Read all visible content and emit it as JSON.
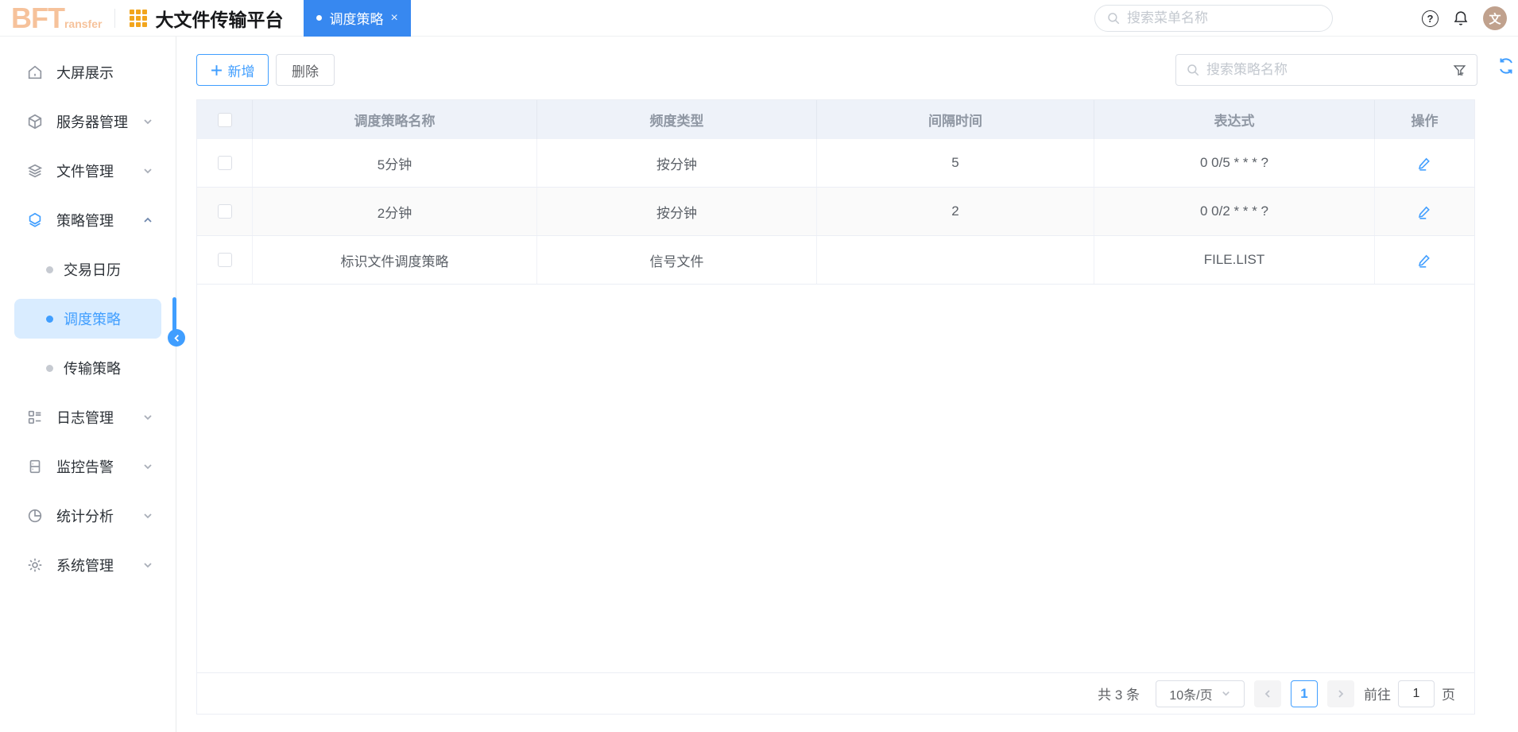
{
  "colors": {
    "primary": "#409eff",
    "tab_blue": "#3788f0",
    "brand_orange": "#f2a51c",
    "logo_peach": "#f6c29b",
    "active_item_bg": "#d9ecff",
    "table_header_bg": "#eef2f9"
  },
  "header": {
    "logo_main": "BFT",
    "logo_sub": "ransfer",
    "app_title": "大文件传输平台",
    "tab_label": "调度策略",
    "tab_close": "×",
    "menu_search_placeholder": "搜索菜单名称",
    "avatar_text": "文"
  },
  "sidebar": {
    "items": [
      {
        "label": "大屏展示"
      },
      {
        "label": "服务器管理"
      },
      {
        "label": "文件管理"
      },
      {
        "label": "策略管理"
      },
      {
        "label": "交易日历"
      },
      {
        "label": "调度策略"
      },
      {
        "label": "传输策略"
      },
      {
        "label": "日志管理"
      },
      {
        "label": "监控告警"
      },
      {
        "label": "统计分析"
      },
      {
        "label": "系统管理"
      }
    ]
  },
  "toolbar": {
    "add_label": "新增",
    "delete_label": "删除",
    "search_placeholder": "搜索策略名称"
  },
  "table": {
    "columns": [
      "调度策略名称",
      "频度类型",
      "间隔时间",
      "表达式",
      "操作"
    ],
    "rows": [
      {
        "name": "5分钟",
        "freq": "按分钟",
        "interval": "5",
        "expr": "0 0/5 * * * ?"
      },
      {
        "name": "2分钟",
        "freq": "按分钟",
        "interval": "2",
        "expr": "0 0/2 * * * ?"
      },
      {
        "name": "标识文件调度策略",
        "freq": "信号文件",
        "interval": "",
        "expr": "FILE.LIST"
      }
    ]
  },
  "pagination": {
    "total": "共 3 条",
    "page_size": "10条/页",
    "current_page": "1",
    "goto_label": "前往",
    "goto_value": "1",
    "page_unit": "页"
  }
}
